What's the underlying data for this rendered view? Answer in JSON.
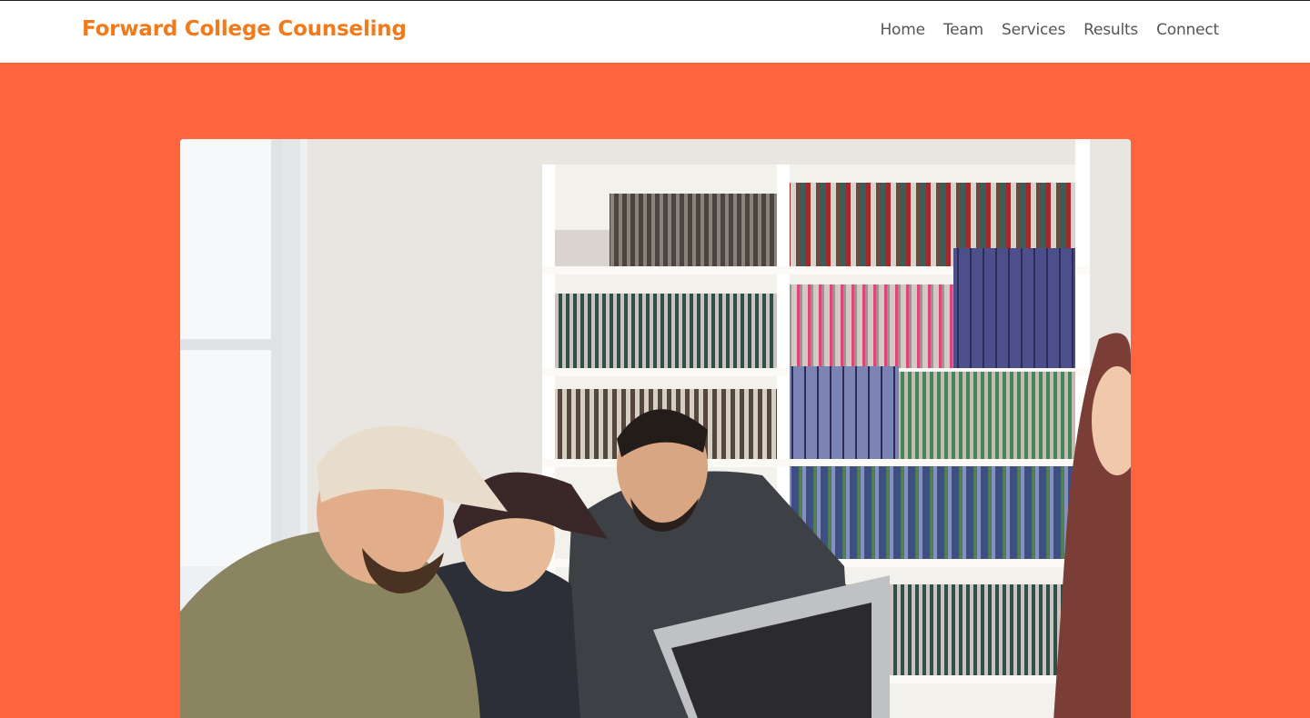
{
  "brand": {
    "name": "Forward College Counseling",
    "color": "#f27a1a"
  },
  "nav": {
    "items": [
      {
        "label": "Home"
      },
      {
        "label": "Team"
      },
      {
        "label": "Services"
      },
      {
        "label": "Results"
      },
      {
        "label": "Connect"
      }
    ]
  },
  "page": {
    "background": "#ff643c"
  },
  "hero": {
    "image": "group-study-photo"
  }
}
